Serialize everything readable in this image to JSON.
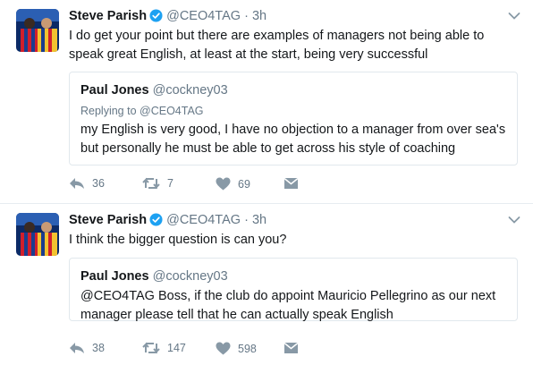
{
  "tweets": [
    {
      "name": "Steve Parish",
      "handle": "@CEO4TAG",
      "dot": "·",
      "time": "3h",
      "text": "I do get your point but there are examples of managers not being able to speak great English, at least at the start, being very successful",
      "quote": {
        "name": "Paul Jones",
        "handle": "@cockney03",
        "replying_to": "Replying to @CEO4TAG",
        "text": "my English is very good, I have no objection to a manager from over sea's but personally he must be able to get across his style of coaching"
      },
      "counts": {
        "replies": "36",
        "retweets": "7",
        "likes": "69"
      }
    },
    {
      "name": "Steve Parish",
      "handle": "@CEO4TAG",
      "dot": "·",
      "time": "3h",
      "text": "I think the bigger question is can you?",
      "quote": {
        "name": "Paul Jones",
        "handle": "@cockney03",
        "text": "@CEO4TAG Boss, if the club do appoint Mauricio Pellegrino as our next manager please tell that he can actually speak English"
      },
      "counts": {
        "replies": "38",
        "retweets": "147",
        "likes": "598"
      }
    }
  ],
  "colors": {
    "text": "#14171a",
    "muted": "#657786",
    "verified": "#1da1f2",
    "border": "#e1e8ed",
    "background": "#f5f8fa"
  },
  "icons": [
    "verified-badge-icon",
    "chevron-down-icon",
    "reply-icon",
    "retweet-icon",
    "like-icon",
    "direct-message-icon"
  ]
}
